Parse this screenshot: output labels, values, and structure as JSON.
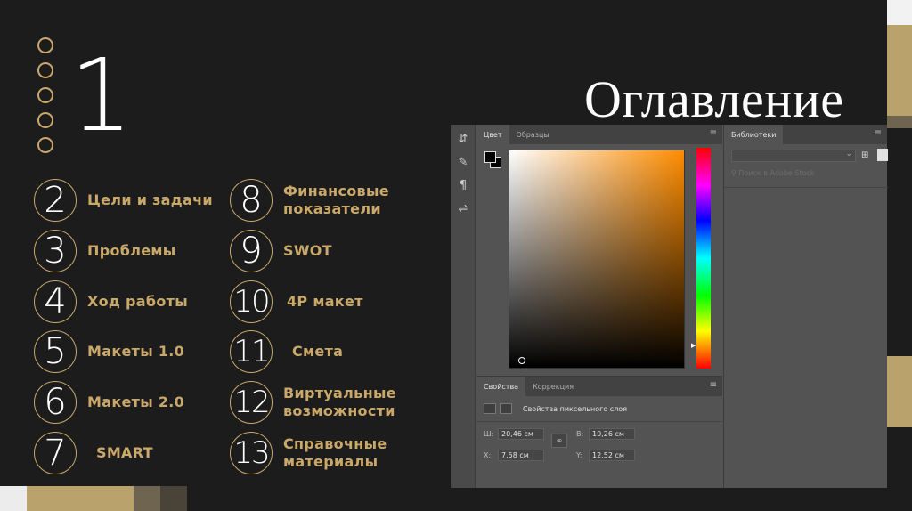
{
  "slide": {
    "big_number": "1",
    "title": "Оглавление"
  },
  "toc": [
    {
      "num": "2",
      "label": [
        "Цели и задачи"
      ]
    },
    {
      "num": "3",
      "label": [
        "Проблемы"
      ]
    },
    {
      "num": "4",
      "label": [
        "Ход работы"
      ]
    },
    {
      "num": "5",
      "label": [
        "Макеты 1.0"
      ]
    },
    {
      "num": "6",
      "label": [
        "Макеты 2.0"
      ]
    },
    {
      "num": "7",
      "label": [
        "SMART"
      ]
    },
    {
      "num": "8",
      "label": [
        "Финансовые",
        "показатели"
      ]
    },
    {
      "num": "9",
      "label": [
        "SWOT"
      ]
    },
    {
      "num": "10",
      "label": [
        "4P макет"
      ]
    },
    {
      "num": "11",
      "label": [
        "Смета"
      ]
    },
    {
      "num": "12",
      "label": [
        "Виртуальные",
        "возможности"
      ]
    },
    {
      "num": "13",
      "label": [
        "Справочные",
        "материалы"
      ]
    }
  ],
  "photoshop": {
    "color_panel": {
      "tabs": [
        "Цвет",
        "Образцы"
      ],
      "menu": "≡"
    },
    "libraries_panel": {
      "tab": "Библиотеки",
      "search_placeholder": "Поиск в Adobe Stock",
      "menu": "≡"
    },
    "properties_panel": {
      "tabs": [
        "Свойства",
        "Коррекция"
      ],
      "menu": "≡",
      "title": "Свойства пиксельного слоя",
      "w_label": "Ш:",
      "w_value": "20,46 см",
      "h_label": "В:",
      "h_value": "10,26 см",
      "x_label": "X:",
      "x_value": "7,58 см",
      "y_label": "Y:",
      "y_value": "12,52 см",
      "link_icon": "link-icon"
    }
  },
  "colors": {
    "background": "#1c1c1c",
    "gold": "#c9a86a",
    "accent_bar": "#b9a26c",
    "text": "#ffffff"
  }
}
